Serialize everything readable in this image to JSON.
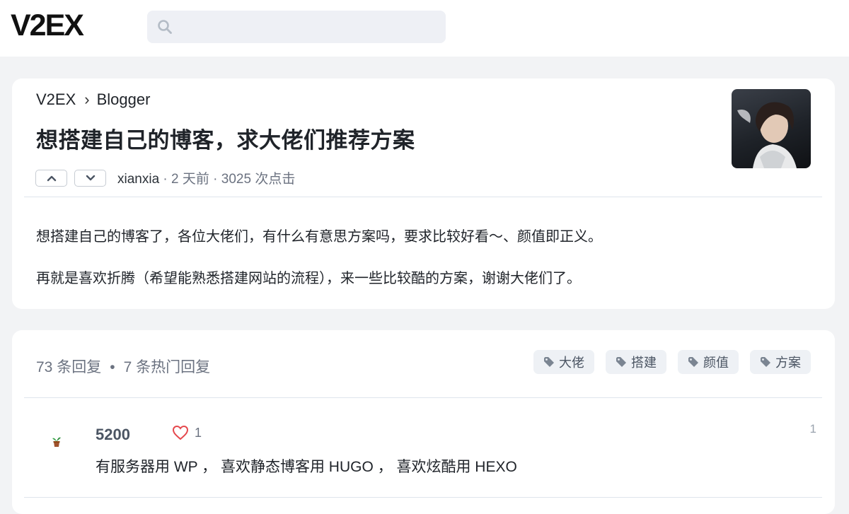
{
  "header": {
    "logo": "V2EX",
    "search_placeholder": ""
  },
  "topic": {
    "breadcrumb": {
      "root": "V2EX",
      "separator": "›",
      "node": "Blogger"
    },
    "title": "想搭建自己的博客，求大佬们推荐方案",
    "author": "xianxia",
    "meta_rest": " · 2 天前 · 3025 次点击",
    "content": [
      "想搭建自己的博客了，各位大佬们，有什么有意思方案吗，要求比较好看～、颜值即正义。",
      "再就是喜欢折腾（希望能熟悉搭建网站的流程），来一些比较酷的方案，谢谢大佬们了。"
    ]
  },
  "replies": {
    "count_text": "73 条回复",
    "dot": "•",
    "hot_text": "7 条热门回复",
    "tags": [
      "大佬",
      "搭建",
      "颜值",
      "方案"
    ],
    "items": [
      {
        "user": "5200",
        "likes": "1",
        "floor": "1",
        "text": "有服务器用 WP ， 喜欢静态博客用 HUGO ， 喜欢炫酷用 HEXO"
      }
    ]
  },
  "colors": {
    "accent": "#1f2329",
    "muted": "#6b7280",
    "heart": "#e5484d",
    "card_bg": "#ffffff",
    "page_bg": "#f2f3f5"
  },
  "icons": {
    "search": "search-icon",
    "upvote": "chevron-up-icon",
    "downvote": "chevron-down-icon",
    "tag": "tag-icon",
    "like": "heart-icon"
  }
}
